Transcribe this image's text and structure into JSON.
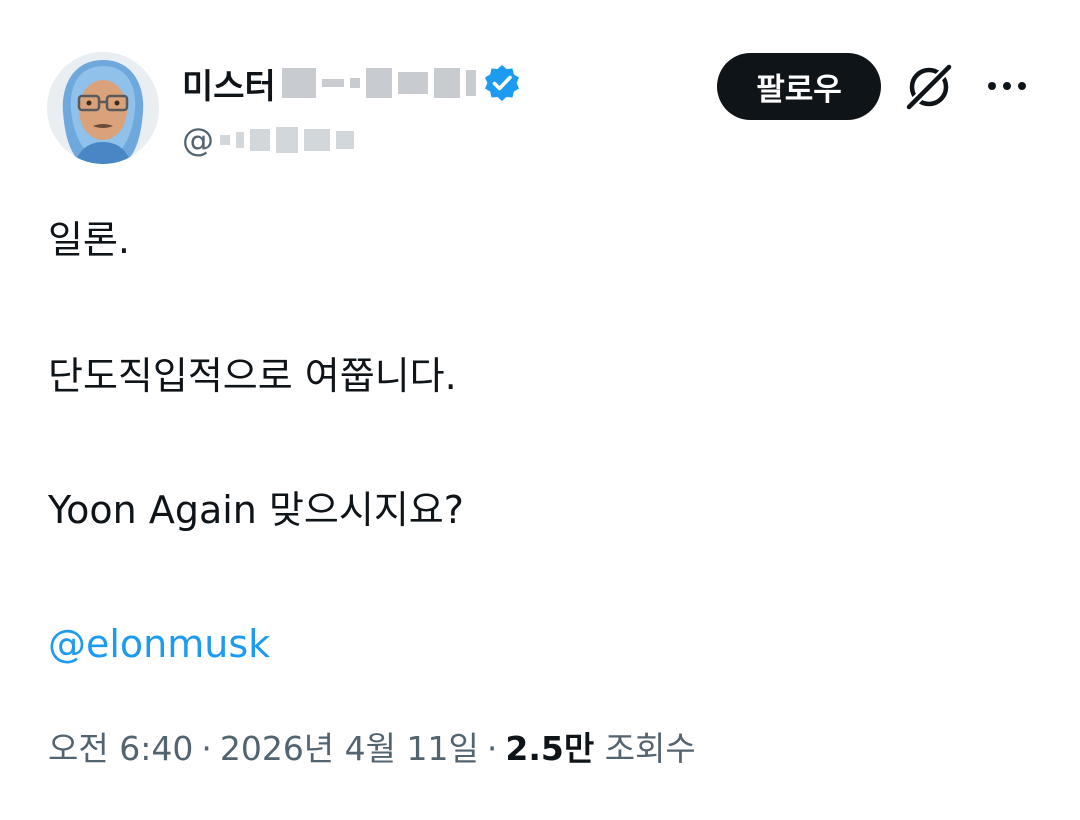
{
  "tweet": {
    "author": {
      "display_name": "미스터",
      "verified_icon": "verified-badge-icon",
      "handle_prefix": "@",
      "avatar_icon": "avatar-memoji-icon"
    },
    "actions": {
      "follow_label": "팔로우",
      "grok_icon": "grok-icon",
      "more_icon": "more-dots-icon"
    },
    "body": {
      "line1": "일론.",
      "line2": "단도직입적으로 여쭙니다.",
      "line3": "Yoon Again 맞으시지요?",
      "mention": "@elonmusk"
    },
    "meta": {
      "time": "오전 6:40",
      "separator": "·",
      "date": "2026년 4월 11일",
      "views_count": "2.5만",
      "views_label": "조회수"
    }
  },
  "colors": {
    "text_primary": "#0f1419",
    "text_secondary": "#536471",
    "link": "#1d9bf0",
    "verified": "#1d9bf0",
    "follow_bg": "#0f1419"
  }
}
